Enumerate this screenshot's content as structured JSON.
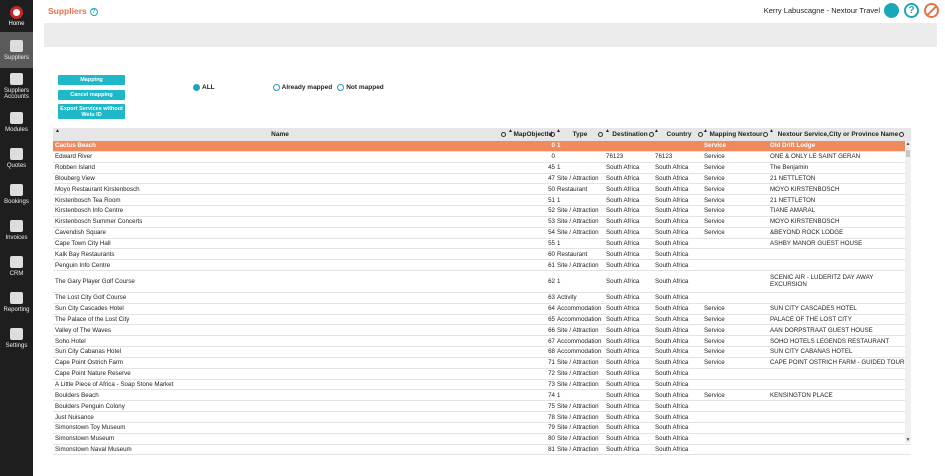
{
  "sidebar": {
    "items": [
      {
        "label": "Home",
        "icon": "home-icon"
      },
      {
        "label": "Suppliers",
        "icon": "suppliers-icon"
      },
      {
        "label": "Suppliers Accounts",
        "icon": "accounts-icon"
      },
      {
        "label": "Modules",
        "icon": "modules-icon"
      },
      {
        "label": "Quotes",
        "icon": "quotes-icon"
      },
      {
        "label": "Bookings",
        "icon": "bookings-icon"
      },
      {
        "label": "Invoices",
        "icon": "invoices-icon"
      },
      {
        "label": "CRM",
        "icon": "crm-icon"
      },
      {
        "label": "Reporting",
        "icon": "reporting-icon"
      },
      {
        "label": "Settings",
        "icon": "settings-icon"
      }
    ]
  },
  "header": {
    "title": "Suppliers",
    "help": "?",
    "user": "Kerry Labuscagne - Nextour Travel"
  },
  "buttons": {
    "mapping": "Mapping",
    "cancel": "Cancel mapping",
    "export": "Export Services without Wetu ID"
  },
  "filters": {
    "all": "ALL",
    "mapped": "Already mapped",
    "not_mapped": "Not mapped"
  },
  "table": {
    "headers": {
      "name": "Name",
      "map": "MapObjectId",
      "type": "Type",
      "dest": "Destination",
      "country": "Country",
      "mapping": "Mapping Nextour",
      "service": "Nextour Service,City or Province Name"
    },
    "rows": [
      {
        "name": "Cactus Beach",
        "map": "0",
        "type": "1",
        "dest": "",
        "country": "",
        "mapping": "Service",
        "service": "Old Drift Lodge"
      },
      {
        "name": "Edward River",
        "map": "0",
        "type": "",
        "dest": "76123",
        "country": "76123",
        "mapping": "Service",
        "service": "ONE & ONLY LE SAINT GERAN"
      },
      {
        "name": "Robben Island",
        "map": "45",
        "type": "1",
        "dest": "South Africa",
        "country": "South Africa",
        "mapping": "Service",
        "service": "The Benjamin"
      },
      {
        "name": "Blouberg View",
        "map": "47",
        "type": "Site / Attraction",
        "dest": "South Africa",
        "country": "South Africa",
        "mapping": "Service",
        "service": "21 NETTLETON"
      },
      {
        "name": "Moyo Restaurant Kirstenbosch",
        "map": "50",
        "type": "Restaurant",
        "dest": "South Africa",
        "country": "South Africa",
        "mapping": "Service",
        "service": "MOYO KIRSTENBOSCH"
      },
      {
        "name": "Kirstenbosch Tea Room",
        "map": "51",
        "type": "1",
        "dest": "South Africa",
        "country": "South Africa",
        "mapping": "Service",
        "service": "21 NETTLETON"
      },
      {
        "name": "Kirstenbosch Info Centre",
        "map": "52",
        "type": "Site / Attraction",
        "dest": "South Africa",
        "country": "South Africa",
        "mapping": "Service",
        "service": "TIANE AMARAL"
      },
      {
        "name": "Kirstenbosch Summer Concerts",
        "map": "53",
        "type": "Site / Attraction",
        "dest": "South Africa",
        "country": "South Africa",
        "mapping": "Service",
        "service": "MOYO KIRSTENBOSCH"
      },
      {
        "name": "Cavendish Square",
        "map": "54",
        "type": "Site / Attraction",
        "dest": "South Africa",
        "country": "South Africa",
        "mapping": "Service",
        "service": "&BEYOND ROCK LODGE"
      },
      {
        "name": "Cape Town City Hall",
        "map": "55",
        "type": "1",
        "dest": "South Africa",
        "country": "South Africa",
        "mapping": "",
        "service": "ASHBY MANOR GUEST HOUSE"
      },
      {
        "name": "Kalk Bay Restaurants",
        "map": "60",
        "type": "Restaurant",
        "dest": "South Africa",
        "country": "South Africa",
        "mapping": "",
        "service": ""
      },
      {
        "name": "Penguin Info Centre",
        "map": "61",
        "type": "Site / Attraction",
        "dest": "South Africa",
        "country": "South Africa",
        "mapping": "",
        "service": ""
      },
      {
        "name": "The Gary Player Golf Course",
        "map": "62",
        "type": "1",
        "dest": "South Africa",
        "country": "South Africa",
        "mapping": "",
        "service": "SCENIC AIR - LUDERITZ DAY AWAY EXCURSION",
        "tall": true
      },
      {
        "name": "The Lost City Golf Course",
        "map": "63",
        "type": "Activity",
        "dest": "South Africa",
        "country": "South Africa",
        "mapping": "",
        "service": ""
      },
      {
        "name": "Sun City Cascades Hotel",
        "map": "64",
        "type": "Accommodation",
        "dest": "South Africa",
        "country": "South Africa",
        "mapping": "Service",
        "service": "SUN CITY CASCADES HOTEL"
      },
      {
        "name": "The Palace of the Lost City",
        "map": "65",
        "type": "Accommodation",
        "dest": "South Africa",
        "country": "South Africa",
        "mapping": "Service",
        "service": "PALACE OF THE LOST CITY"
      },
      {
        "name": "Valley of The Waves",
        "map": "66",
        "type": "Site / Attraction",
        "dest": "South Africa",
        "country": "South Africa",
        "mapping": "Service",
        "service": "AAN DORPSTRAAT GUEST HOUSE"
      },
      {
        "name": "Soho Hotel",
        "map": "67",
        "type": "Accommodation",
        "dest": "South Africa",
        "country": "South Africa",
        "mapping": "Service",
        "service": "SOHO HOTELS LEGENDS RESTAURANT"
      },
      {
        "name": "Sun City Cabanas Hotel",
        "map": "68",
        "type": "Accommodation",
        "dest": "South Africa",
        "country": "South Africa",
        "mapping": "Service",
        "service": "SUN CITY CABANAS HOTEL"
      },
      {
        "name": "Cape Point Ostrich Farm",
        "map": "71",
        "type": "Site / Attraction",
        "dest": "South Africa",
        "country": "South Africa",
        "mapping": "Service",
        "service": "CAPE POINT OSTRICH FARM - GUIDED TOURS"
      },
      {
        "name": "Cape Point Nature Reserve",
        "map": "72",
        "type": "Site / Attraction",
        "dest": "South Africa",
        "country": "South Africa",
        "mapping": "",
        "service": ""
      },
      {
        "name": "A Little Piece of Africa - Soap Stone Market",
        "map": "73",
        "type": "Site / Attraction",
        "dest": "South Africa",
        "country": "South Africa",
        "mapping": "",
        "service": ""
      },
      {
        "name": "Boulders Beach",
        "map": "74",
        "type": "1",
        "dest": "South Africa",
        "country": "South Africa",
        "mapping": "Service",
        "service": "KENSINGTON PLACE"
      },
      {
        "name": "Boulders Penguin Colony",
        "map": "75",
        "type": "Site / Attraction",
        "dest": "South Africa",
        "country": "South Africa",
        "mapping": "",
        "service": ""
      },
      {
        "name": "Just Nuisance",
        "map": "78",
        "type": "Site / Attraction",
        "dest": "South Africa",
        "country": "South Africa",
        "mapping": "",
        "service": ""
      },
      {
        "name": "Simonstown Toy Museum",
        "map": "79",
        "type": "Site / Attraction",
        "dest": "South Africa",
        "country": "South Africa",
        "mapping": "",
        "service": ""
      },
      {
        "name": "Simonstown Museum",
        "map": "80",
        "type": "Site / Attraction",
        "dest": "South Africa",
        "country": "South Africa",
        "mapping": "",
        "service": ""
      },
      {
        "name": "Simonstown Naval Museum",
        "map": "81",
        "type": "Site / Attraction",
        "dest": "South Africa",
        "country": "South Africa",
        "mapping": "",
        "service": ""
      }
    ]
  },
  "colors": {
    "accent": "#1fb8c8",
    "selected_row": "#f08a5d",
    "title": "#e8704a",
    "sidebar": "#1e1e1e"
  }
}
